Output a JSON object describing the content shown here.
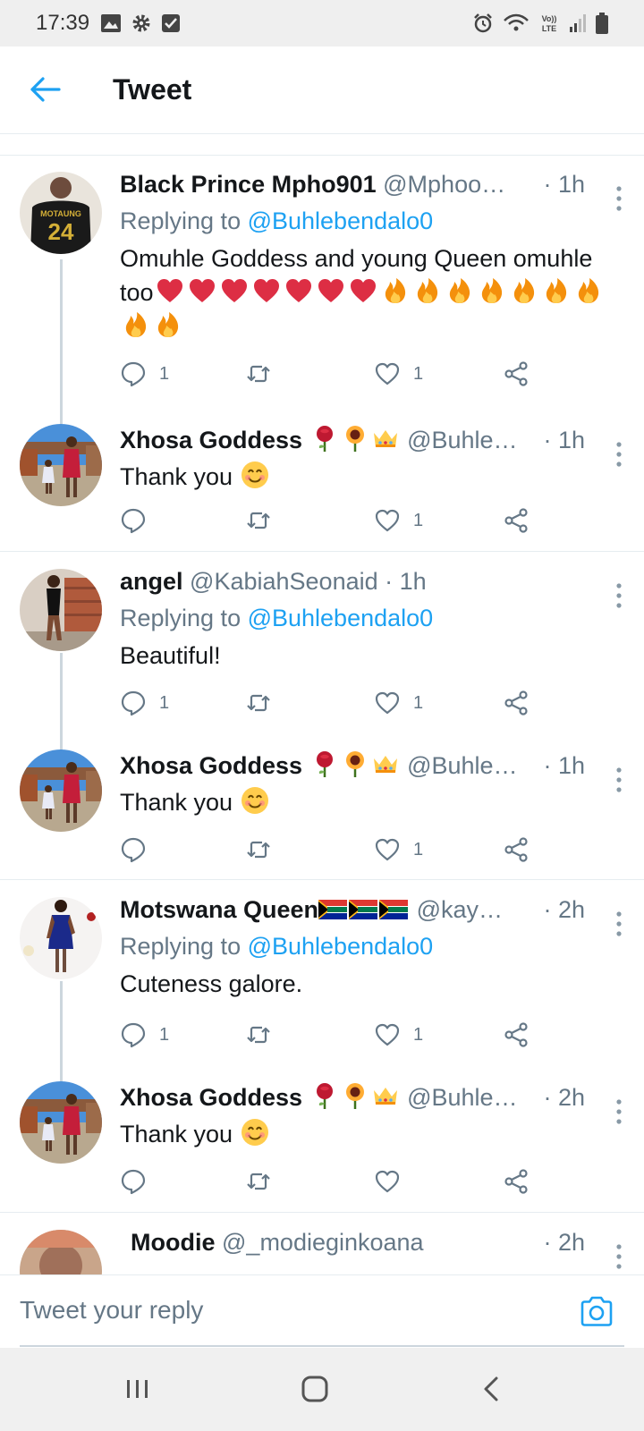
{
  "status_bar": {
    "time": "17:39",
    "icons_left": [
      "image-icon",
      "gear-icon",
      "checkbox-icon"
    ],
    "icons_right": [
      "alarm-icon",
      "wifi-icon",
      "volte-icon",
      "signal-icon",
      "battery-icon"
    ],
    "volte_text": "Vo)) LTE"
  },
  "header": {
    "title": "Tweet"
  },
  "tweets": [
    {
      "name": "Black Prince Mpho901",
      "handle": "@Mphoo…",
      "time": "· 1h",
      "replying_prefix": "Replying to ",
      "replying_to": "@Buhlebendalo0",
      "text": "Omuhle Goddess  and young Queen omuhle too",
      "reply_count": "1",
      "retweet_count": "",
      "like_count": "1"
    },
    {
      "name": "Xhosa Goddess",
      "handle": "@Buhle…",
      "time": "· 1h",
      "text": "Thank you",
      "reply_count": "",
      "retweet_count": "",
      "like_count": "1"
    },
    {
      "name": "angel",
      "handle": "@KabiahSeonaid",
      "time": "· 1h",
      "replying_prefix": "Replying to ",
      "replying_to": "@Buhlebendalo0",
      "text": "Beautiful!",
      "reply_count": "1",
      "retweet_count": "",
      "like_count": "1"
    },
    {
      "name": "Xhosa Goddess",
      "handle": "@Buhle…",
      "time": "· 1h",
      "text": "Thank you",
      "reply_count": "",
      "retweet_count": "",
      "like_count": "1"
    },
    {
      "name": "Motswana Queen",
      "handle": "@kay…",
      "time": "· 2h",
      "replying_prefix": "Replying to ",
      "replying_to": "@Buhlebendalo0",
      "text": "Cuteness galore.",
      "reply_count": "1",
      "retweet_count": "",
      "like_count": "1"
    },
    {
      "name": "Xhosa Goddess",
      "handle": "@Buhle…",
      "time": "· 2h",
      "text": "Thank you",
      "reply_count": "",
      "retweet_count": "",
      "like_count": ""
    },
    {
      "name": "Moodie",
      "handle": "@_modieginkoana",
      "time": "· 2h"
    }
  ],
  "reply_bar": {
    "placeholder": "Tweet your reply"
  },
  "colors": {
    "accent": "#1da1f2",
    "text": "#14171a",
    "secondary": "#657786",
    "divider": "#e6ecf0"
  }
}
